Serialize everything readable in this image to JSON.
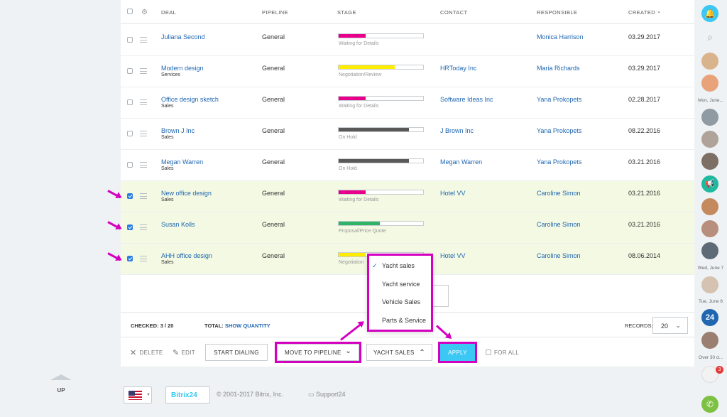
{
  "left": {
    "up_label": "UP"
  },
  "columns": {
    "deal": "DEAL",
    "pipeline": "PIPELINE",
    "stage": "STAGE",
    "contact": "CONTACT",
    "responsible": "RESPONSIBLE",
    "created": "CREATED"
  },
  "rows": [
    {
      "name": "Juliana Second",
      "sub": "",
      "pipeline": "General",
      "stage": "Waiting for Details",
      "stage_color": "#e8008c",
      "progress": 0.32,
      "contact": "",
      "responsible": "Monica Harrison",
      "created": "03.29.2017",
      "checked": false
    },
    {
      "name": "Modern design",
      "sub": "Services",
      "pipeline": "General",
      "stage": "Negotiation/Review",
      "stage_color": "#ffed00",
      "progress": 0.66,
      "contact": "HRToday Inc",
      "responsible": "Maria Richards",
      "created": "03.29.2017",
      "checked": false
    },
    {
      "name": "Office design sketch",
      "sub": "Sales",
      "pipeline": "General",
      "stage": "Waiting for Details",
      "stage_color": "#e8008c",
      "progress": 0.32,
      "contact": "Software Ideas Inc",
      "responsible": "Yana Prokopets",
      "created": "02.28.2017",
      "checked": false
    },
    {
      "name": "Brown J Inc",
      "sub": "Sales",
      "pipeline": "General",
      "stage": "On Hold",
      "stage_color": "#595959",
      "progress": 0.83,
      "contact": "J Brown Inc",
      "responsible": "Yana Prokopets",
      "created": "08.22.2016",
      "checked": false
    },
    {
      "name": "Megan Warren",
      "sub": "Sales",
      "pipeline": "General",
      "stage": "On Hold",
      "stage_color": "#595959",
      "progress": 0.83,
      "contact": "Megan Warren",
      "responsible": "Yana Prokopets",
      "created": "03.21.2016",
      "checked": false
    },
    {
      "name": "New office design",
      "sub": "Sales",
      "pipeline": "General",
      "stage": "Waiting for Details",
      "stage_color": "#e8008c",
      "progress": 0.32,
      "contact": "Hotel VV",
      "responsible": "Caroline Simon",
      "created": "03.21.2016",
      "checked": true
    },
    {
      "name": "Susan Kolls",
      "sub": "",
      "pipeline": "General",
      "stage": "Proposal/Price Quote",
      "stage_color": "#2fb366",
      "progress": 0.49,
      "contact": "",
      "responsible": "Caroline Simon",
      "created": "03.21.2016",
      "checked": true
    },
    {
      "name": "AHH office design",
      "sub": "Sales",
      "pipeline": "General",
      "stage": "Negotiation",
      "stage_color": "#ffed00",
      "progress": 0.32,
      "contact": "Hotel VV",
      "responsible": "Caroline Simon",
      "created": "08.06.2014",
      "checked": true
    }
  ],
  "summary": {
    "checked_label": "CHECKED:",
    "checked_value": "3 / 20",
    "total_label": "TOTAL:",
    "total_link": "SHOW QUANTITY",
    "records_label": "RECORDS:",
    "records_value": "20"
  },
  "actions": {
    "delete": "DELETE",
    "edit": "EDIT",
    "start_dialing": "START DIALING",
    "move_to_pipeline": "MOVE TO PIPELINE",
    "pipeline_select": "YACHT SALES",
    "apply": "APPLY",
    "for_all": "FOR ALL"
  },
  "dropdown": {
    "options": [
      "Yacht sales",
      "Yacht service",
      "Vehicle Sales",
      "Parts & Service"
    ],
    "selected": "Yacht sales"
  },
  "footer": {
    "copyright": "© 2001-2017 Bitrix, Inc.",
    "support": "Support24",
    "logo": "Bitrix24"
  },
  "right": {
    "labels": [
      "Mon, June...",
      "Wed, June 7",
      "Tue, June 6",
      "Over 30 d..."
    ],
    "badge": "3",
    "logo": "24"
  },
  "colors": {
    "accent": "#3bc8f5",
    "highlight": "#d400c0",
    "link": "#2067b0"
  }
}
